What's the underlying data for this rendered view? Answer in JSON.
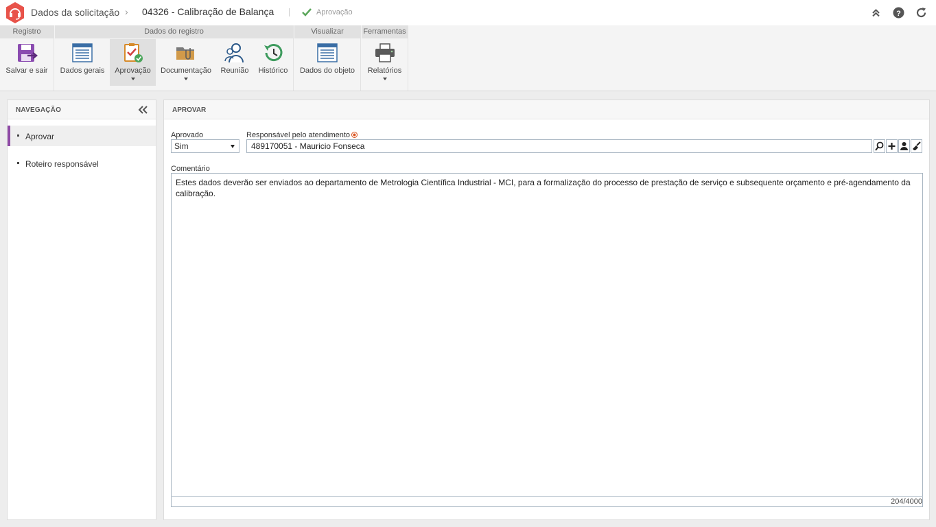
{
  "header": {
    "root": "Dados da solicitação",
    "separator": "›",
    "title": "04326 - Calibração de Balança",
    "status": "Aprovação"
  },
  "colors": {
    "brand": "#e8534a",
    "accent_purple": "#8f4aa6",
    "ribbon_bg": "#f4f4f4"
  },
  "ribbon": {
    "groups": [
      {
        "title": "Registro"
      },
      {
        "title": "Dados do registro"
      },
      {
        "title": "Visualizar"
      },
      {
        "title": "Ferramentas"
      }
    ],
    "buttons": {
      "save_exit": "Salvar e sair",
      "general": "Dados gerais",
      "approval": "Aprovação",
      "documentation": "Documentação",
      "meeting": "Reunião",
      "history": "Histórico",
      "object": "Dados do objeto",
      "reports": "Relatórios"
    }
  },
  "nav": {
    "title": "NAVEGAÇÃO",
    "items": [
      {
        "label": "Aprovar",
        "active": true
      },
      {
        "label": "Roteiro responsável",
        "active": false
      }
    ]
  },
  "main": {
    "title": "APROVAR",
    "approved_label": "Aprovado",
    "approved_value": "Sim",
    "responsible_label": "Responsável pelo atendimento",
    "responsible_value": "489170051 - Mauricio Fonseca",
    "comment_label": "Comentário",
    "comment_value": "Estes dados deverão ser enviados ao departamento de Metrologia Científica Industrial - MCI, para a formalização do processo de prestação de serviço e subsequente orçamento e pré-agendamento da calibração.",
    "char_count": "204/4000"
  }
}
